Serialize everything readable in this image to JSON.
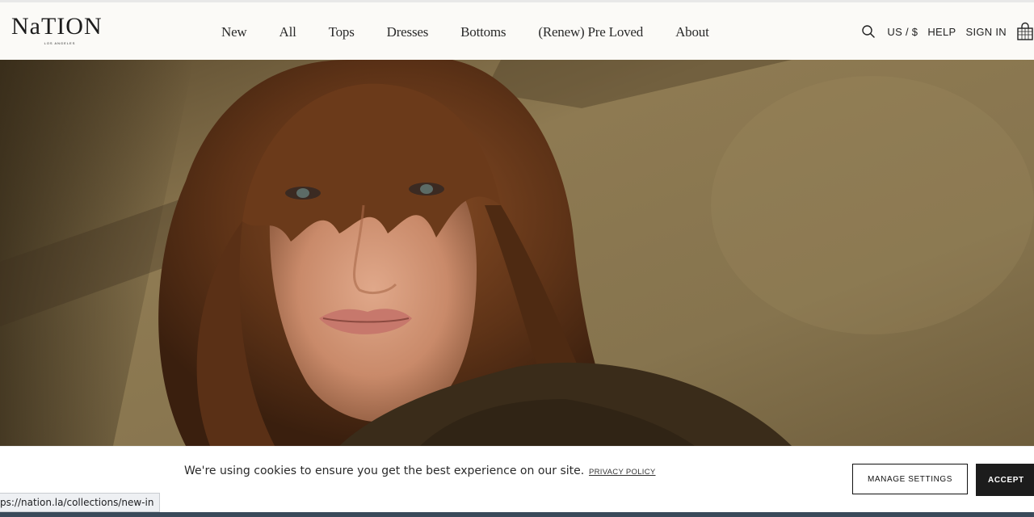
{
  "header": {
    "logo": {
      "main": "NaTION",
      "sub": "LOS ANGELES"
    },
    "nav": [
      {
        "label": "New"
      },
      {
        "label": "All"
      },
      {
        "label": "Tops"
      },
      {
        "label": "Dresses"
      },
      {
        "label": "Bottoms"
      },
      {
        "label": "(Renew) Pre Loved"
      },
      {
        "label": "About"
      }
    ],
    "utility": {
      "search_icon": "search-icon",
      "currency": "US / $",
      "help": "HELP",
      "sign_in": "SIGN IN",
      "cart_icon": "shopping-bag-icon"
    }
  },
  "hero": {
    "image": "portrait of woman with brown bangs against a beige wall"
  },
  "cookie_banner": {
    "message": "We're using cookies to ensure you get the best experience on our site.",
    "privacy_link": "PRIVACY POLICY",
    "manage_button": "MANAGE SETTINGS",
    "accept_button": "ACCEPT"
  },
  "status_bar": {
    "url": "ps://nation.la/collections/new-in"
  },
  "colors": {
    "header_bg": "#fbfaf7",
    "text_dark": "#1c1c1c",
    "accept_bg": "#1c1c1c",
    "hero_wall": "#8a7650"
  }
}
